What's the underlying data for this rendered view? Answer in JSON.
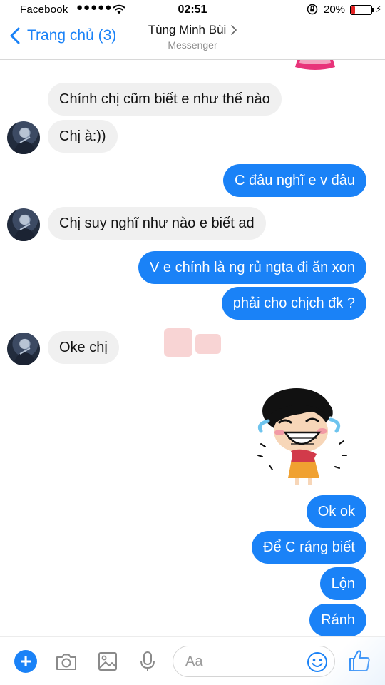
{
  "status_bar": {
    "carrier": "Facebook",
    "signal": "●●●●●",
    "time": "02:51",
    "battery_percent": "20%",
    "battery_level": 0.2,
    "battery_color": "#e52222",
    "icons": [
      "signal-dots-icon",
      "wifi-icon",
      "rotation-lock-icon",
      "battery-icon",
      "charging-bolt-icon"
    ]
  },
  "nav": {
    "back_label": "Trang chủ (3)",
    "contact_name": "Tùng Minh Bùi",
    "contact_subtitle": "Messenger",
    "accent_color": "#1a82f7"
  },
  "messages": [
    {
      "direction": "in",
      "text": "Chính chị cũm biết e như thế nào"
    },
    {
      "direction": "in",
      "text": "Chị à:))"
    },
    {
      "direction": "out",
      "text": "C đâu nghĩ e v đâu"
    },
    {
      "direction": "in",
      "text": "Chị suy nghĩ như nào e biết ad"
    },
    {
      "direction": "out",
      "text": "V e chính là ng rủ ngta đi ăn xon"
    },
    {
      "direction": "out",
      "text": "phải cho chịch đk ?"
    },
    {
      "direction": "in",
      "text": "Oke chị"
    },
    {
      "direction": "out",
      "type": "sticker",
      "icon": "laughing-girl-sticker"
    },
    {
      "direction": "out",
      "text": "Ok ok"
    },
    {
      "direction": "out",
      "text": "Để C ráng biết"
    },
    {
      "direction": "out",
      "text": "Lộn"
    },
    {
      "direction": "out",
      "text": "Ránh"
    }
  ],
  "composer": {
    "placeholder": "Aa",
    "icons": [
      "plus-icon",
      "camera-icon",
      "gallery-icon",
      "microphone-icon",
      "emoji-icon",
      "thumbs-up-icon"
    ]
  },
  "colors": {
    "outgoing_bubble": "#1a82f7",
    "incoming_bubble": "#f0f0f0"
  }
}
